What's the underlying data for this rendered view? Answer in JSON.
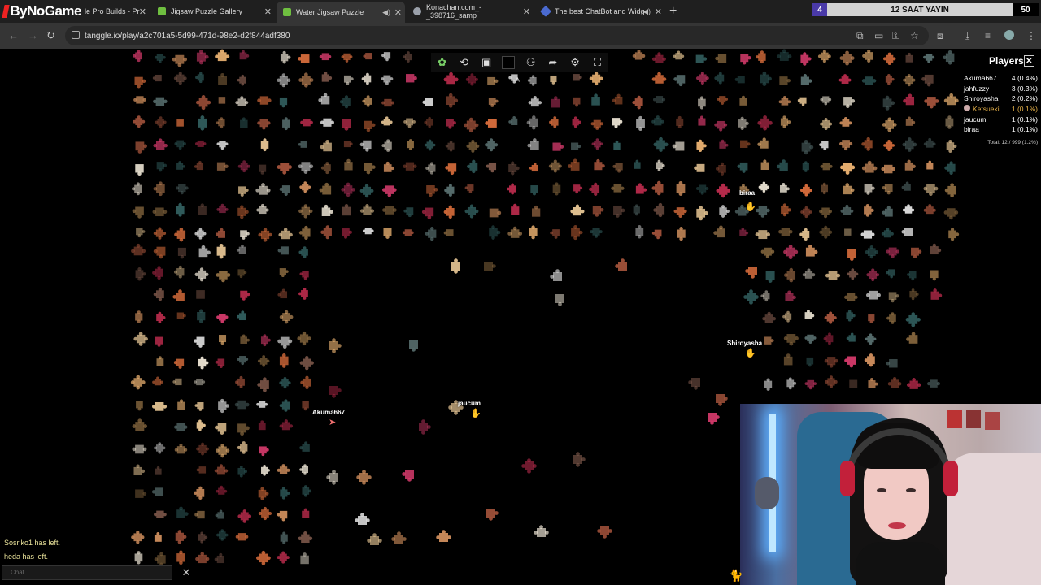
{
  "channel_logo": "ByNoGame",
  "tabs": [
    {
      "title": "le Pro Builds - Pr",
      "icon_color": "#3a8d3a"
    },
    {
      "title": "Jigsaw Puzzle Gallery",
      "icon_color": "#6fbf40"
    },
    {
      "title": "Water Jigsaw Puzzle",
      "icon_color": "#6fbf40"
    },
    {
      "title": "Konachan.com_-_398716_samp",
      "icon_color": "#9aa0aa"
    },
    {
      "title": "The best ChatBot and Widg",
      "icon_color": "#4a6ad0"
    }
  ],
  "broadcast_bar": {
    "number": "4",
    "label": "12 SAAT YAYIN",
    "count": "50"
  },
  "address_bar": {
    "url": "tanggle.io/play/a2c701a5-5d99-471d-98e2-d2f844adf380"
  },
  "toolbar": {
    "icons": [
      "puzzle-icon",
      "rotate-icon",
      "image-preview-icon",
      "background-color-icon",
      "players-icon",
      "share-icon",
      "settings-icon",
      "fullscreen-icon"
    ],
    "collapse_glyph": "˄"
  },
  "players_panel": {
    "title": "Players",
    "close_glyph": "✕",
    "rows": [
      {
        "name": "Akuma667",
        "score": "4 (0.4%)",
        "highlight": false
      },
      {
        "name": "jahfuzzy",
        "score": "3 (0.3%)",
        "highlight": false
      },
      {
        "name": "Shiroyasha",
        "score": "2 (0.2%)",
        "highlight": false
      },
      {
        "name": "Ketsueki",
        "score": "1 (0.1%)",
        "highlight": true
      },
      {
        "name": "jaucum",
        "score": "1 (0.1%)",
        "highlight": false
      },
      {
        "name": "biraa",
        "score": "1 (0.1%)",
        "highlight": false
      }
    ],
    "total": "Total: 12 / 999 (1.2%)"
  },
  "cursors": [
    {
      "name": "biraa",
      "color": "#f5c040"
    },
    {
      "name": "Shiroyasha",
      "color": "#f5c040"
    },
    {
      "name": "jaucum",
      "color": "#f5c040"
    },
    {
      "name": "Akuma667",
      "color": "#f07070"
    }
  ],
  "chat": {
    "messages": [
      "Sosriko1 has left.",
      "heda has left."
    ],
    "placeholder": "Chat",
    "close_glyph": "✕"
  },
  "colors": {
    "piece_palette": [
      "#d9d9d9",
      "#c98a5a",
      "#a0513a",
      "#e8b070",
      "#7a5548",
      "#d23a6a",
      "#2f5a5a",
      "#e0c090",
      "#b52a4a",
      "#556b6b",
      "#f0e8d8",
      "#8a6a40",
      "#d26a3a"
    ],
    "panel_gold": "#e8b34a"
  }
}
